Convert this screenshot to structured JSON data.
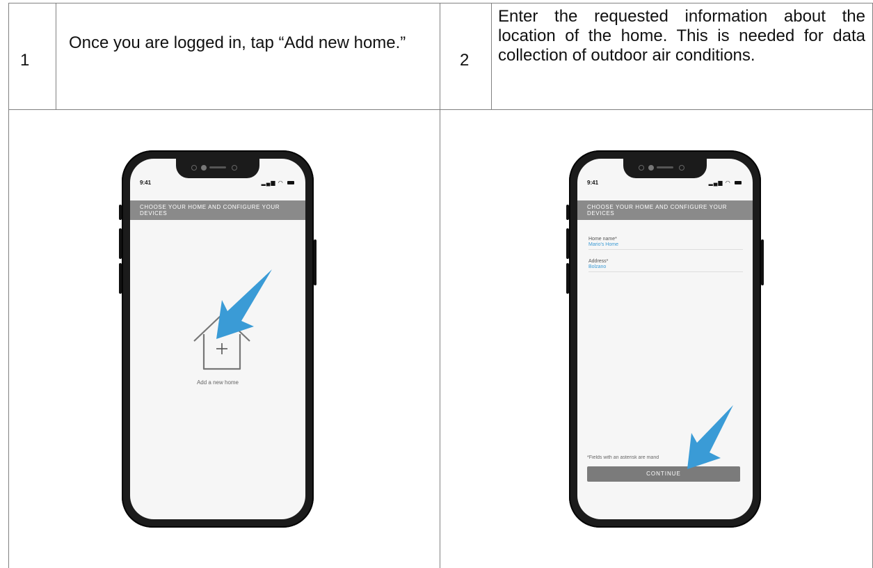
{
  "table": {
    "row": [
      {
        "step": "1",
        "text": "Once you are logged in, tap “Add new home.”"
      },
      {
        "step": "2",
        "text": "Enter the requested information about the location of the home. This is needed for data collection of outdoor air conditions."
      }
    ]
  },
  "phone1": {
    "time": "9:41",
    "header": "CHOOSE YOUR HOME AND CONFIGURE YOUR DEVICES",
    "add_home_label": "Add a new home"
  },
  "phone2": {
    "time": "9:41",
    "header": "CHOOSE YOUR HOME AND CONFIGURE YOUR DEVICES",
    "fields": [
      {
        "label": "Home name*",
        "value": "Mario's Home"
      },
      {
        "label": "Address*",
        "value": "Bolzano"
      }
    ],
    "footnote": "*Fields with an asterisk are mand",
    "continue_label": "CONTINUE"
  },
  "colors": {
    "accent_arrow": "#3a9bd6",
    "header_bar": "#8a8a8a",
    "field_value": "#3b9ad4"
  },
  "icons": [
    "signal-icon",
    "wifi-icon",
    "battery-icon",
    "house-add-icon",
    "pointer-arrow-icon"
  ]
}
